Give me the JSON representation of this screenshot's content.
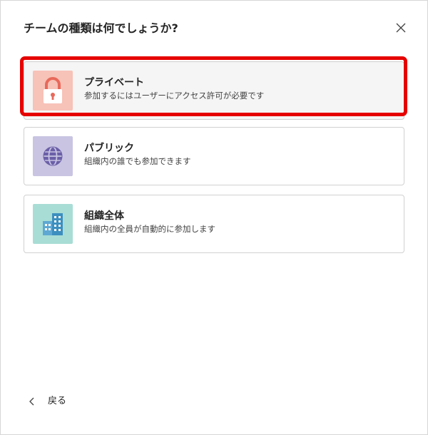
{
  "dialog": {
    "title": "チームの種類は何でしょうか?",
    "close_icon": "close-icon"
  },
  "options": [
    {
      "name": "プライベート",
      "description": "参加するにはユーザーにアクセス許可が必要です",
      "icon": "lock-icon",
      "tile_color": "#f7c2b8",
      "icon_color": "#e8695a",
      "selected": true
    },
    {
      "name": "パブリック",
      "description": "組織内の誰でも参加できます",
      "icon": "globe-icon",
      "tile_color": "#c8c4e2",
      "icon_color": "#6b5fa8",
      "selected": false
    },
    {
      "name": "組織全体",
      "description": "組織内の全員が自動的に参加します",
      "icon": "building-icon",
      "tile_color": "#a8ddd5",
      "icon_color": "#3c8fbf",
      "selected": false
    }
  ],
  "footer": {
    "back_label": "戻る",
    "back_icon": "chevron-left-icon"
  },
  "highlight_color": "#e60000"
}
